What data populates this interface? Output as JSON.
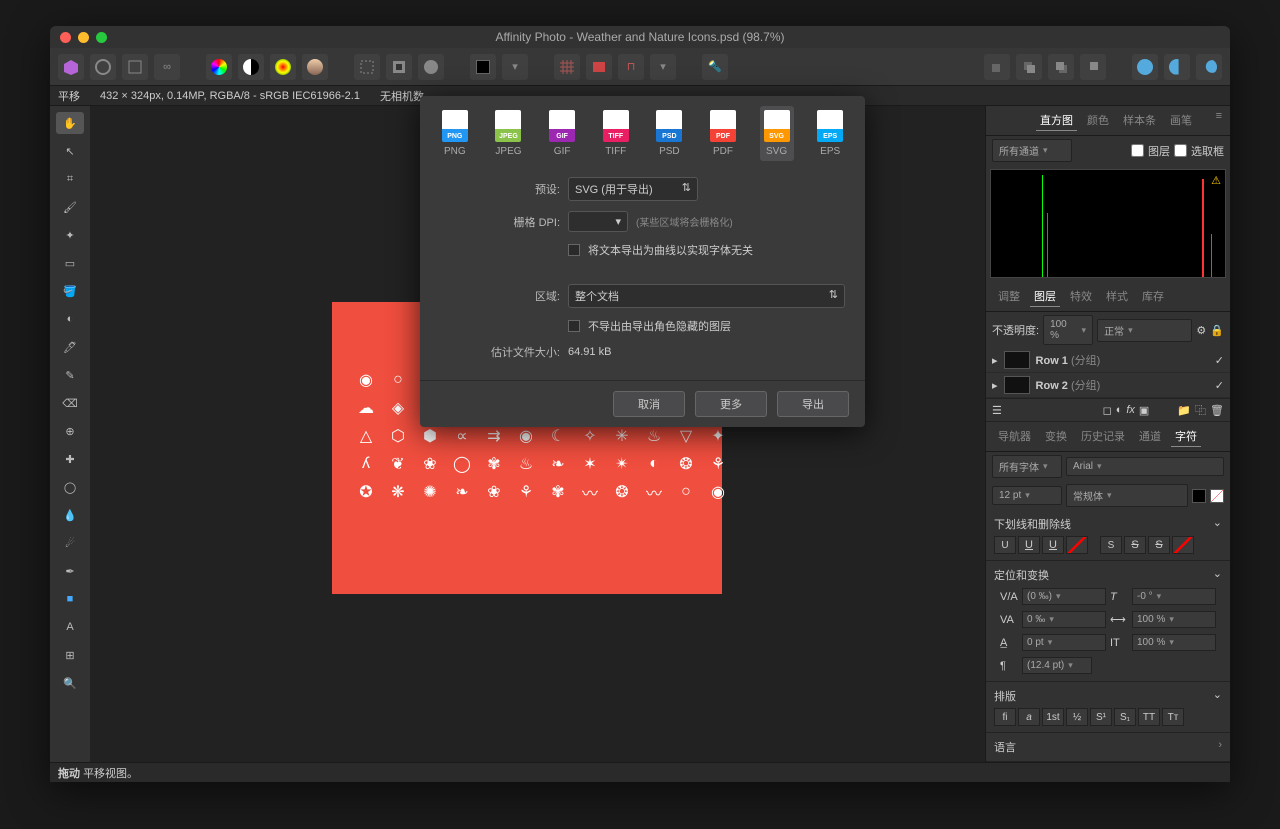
{
  "title": "Affinity Photo - Weather and Nature Icons.psd (98.7%)",
  "infobar": {
    "mode": "平移",
    "docinfo": "432 × 324px, 0.14MP, RGBA/8 - sRGB IEC61966-2.1",
    "camera": "无相机数"
  },
  "export": {
    "formats": [
      {
        "name": "PNG",
        "color": "#2196f3"
      },
      {
        "name": "JPEG",
        "color": "#8bc34a"
      },
      {
        "name": "GIF",
        "color": "#9c27b0"
      },
      {
        "name": "TIFF",
        "color": "#e91e63"
      },
      {
        "name": "PSD",
        "color": "#1976d2"
      },
      {
        "name": "PDF",
        "color": "#f44336"
      },
      {
        "name": "SVG",
        "color": "#ff9800"
      },
      {
        "name": "EPS",
        "color": "#03a9f4"
      }
    ],
    "active_format": "SVG",
    "preset_label": "预设:",
    "preset_value": "SVG (用于导出)",
    "dpi_label": "栅格 DPI:",
    "dpi_note": "(某些区域将会栅格化)",
    "curves_check": "将文本导出为曲线以实现字体无关",
    "area_label": "区域:",
    "area_value": "整个文档",
    "hide_check": "不导出由导出角色隐藏的图层",
    "size_label": "估计文件大小:",
    "size_value": "64.91 kB",
    "btn_cancel": "取消",
    "btn_more": "更多",
    "btn_export": "导出"
  },
  "right": {
    "tabs1": [
      "直方图",
      "颜色",
      "样本条",
      "画笔"
    ],
    "channels": "所有通道",
    "layer_lbl": "图层",
    "selbox_lbl": "选取框",
    "tabs2": [
      "调整",
      "图层",
      "特效",
      "样式",
      "库存"
    ],
    "opacity_label": "不透明度:",
    "opacity_value": "100 %",
    "blend": "正常",
    "layers": [
      {
        "name": "Row 1",
        "suffix": "(分组)"
      },
      {
        "name": "Row 2",
        "suffix": "(分组)"
      }
    ],
    "tabs3": [
      "导航器",
      "变换",
      "历史记录",
      "通道",
      "字符"
    ],
    "font_filter": "所有字体",
    "font_name": "Arial",
    "font_size": "12 pt",
    "font_weight": "常规体",
    "sect_deco": "下划线和删除线",
    "sect_pos": "定位和变换",
    "kern": "(0 ‰)",
    "track": "0 ‰",
    "baseline": "0 pt",
    "leading": "(12.4 pt)",
    "slant": "-0 °",
    "hscale": "100 %",
    "vscale": "100 %",
    "sect_type": "排版",
    "sect_lang": "语言"
  },
  "status": {
    "bold": "拖动",
    "text": "平移视图。"
  }
}
